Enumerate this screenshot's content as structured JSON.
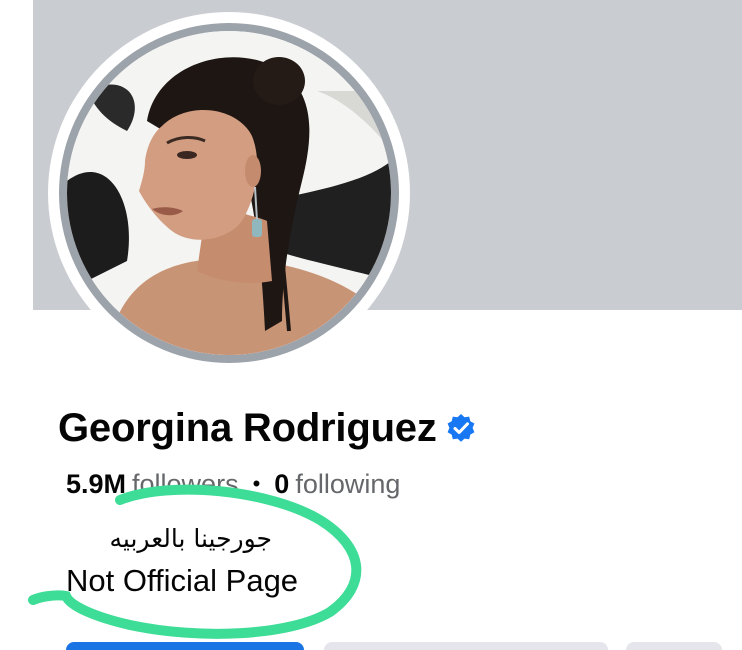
{
  "profile": {
    "name": "Georgina Rodriguez",
    "verified_icon": "verified-badge-icon",
    "avatar_icon": "profile-photo",
    "stats": {
      "followers_count": "5.9M",
      "followers_label": "followers",
      "separator": "•",
      "following_count": "0",
      "following_label": "following"
    },
    "bio": {
      "line1": "جورجينا بالعربيه",
      "line2": "Not Official Page"
    }
  },
  "colors": {
    "cover": "#c9ccd1",
    "verified": "#1877f2",
    "primary_button": "#1b74e4",
    "secondary_button": "#e4e6eb",
    "highlight_marker": "#3ddc97"
  }
}
